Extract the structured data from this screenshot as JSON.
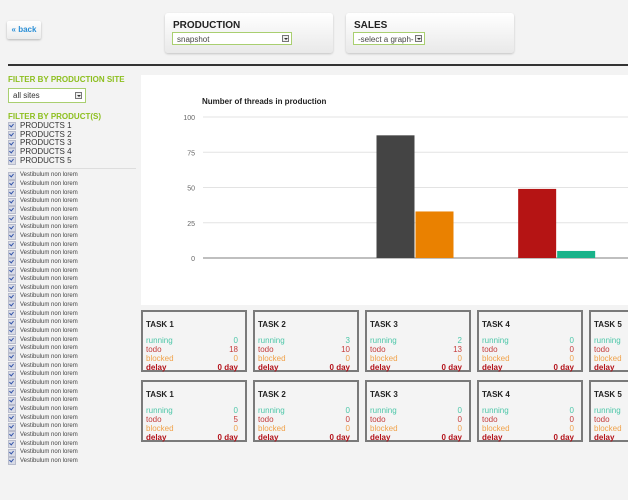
{
  "header": {
    "back_label": "« back",
    "panels": [
      {
        "title": "PRODUCTION",
        "select_value": "snapshot"
      },
      {
        "title": "SALES",
        "select_value": "-select a graph-"
      }
    ]
  },
  "sidebar": {
    "site_filter_heading": "FILTER BY PRODUCTION SITE",
    "site_select_value": "all sites",
    "product_filter_heading": "FILTER BY PRODUCT(S)",
    "products": [
      {
        "label": "PRODUCTS 1",
        "checked": true
      },
      {
        "label": "PRODUCTS 2",
        "checked": true
      },
      {
        "label": "PRODUCTS 3",
        "checked": true
      },
      {
        "label": "PRODUCTS 4",
        "checked": true
      },
      {
        "label": "PRODUCTS 5",
        "checked": true
      }
    ],
    "items_label": "Vestibulum non lorem",
    "items_count": 34
  },
  "chart_data": {
    "type": "bar",
    "title": "Number of threads in production",
    "xlabel": "",
    "ylabel": "",
    "ylim": [
      0,
      100
    ],
    "yticks": [
      0,
      25,
      50,
      75,
      100
    ],
    "grid": true,
    "categories": [
      "",
      "",
      ""
    ],
    "bars": [
      {
        "category": 1,
        "value": 87,
        "color": "#444444"
      },
      {
        "category": 1,
        "value": 33,
        "color": "#ea8100"
      },
      {
        "category": 2,
        "value": 49,
        "color": "#b51414"
      },
      {
        "category": 2,
        "value": 5,
        "color": "#19b38a"
      }
    ]
  },
  "tasks": {
    "labels": {
      "running": "running",
      "todo": "todo",
      "blocked": "blocked",
      "delay": "delay"
    },
    "rows": [
      [
        {
          "name": "TASK 1",
          "running": "0",
          "todo": "18",
          "blocked": "0",
          "delay": "0 day"
        },
        {
          "name": "TASK 2",
          "running": "3",
          "todo": "10",
          "blocked": "0",
          "delay": "0 day"
        },
        {
          "name": "TASK 3",
          "running": "2",
          "todo": "13",
          "blocked": "0",
          "delay": "0 day"
        },
        {
          "name": "TASK 4",
          "running": "0",
          "todo": "0",
          "blocked": "0",
          "delay": "0 day"
        },
        {
          "name": "TASK 5",
          "running": "",
          "todo": "",
          "blocked": "",
          "delay": ""
        }
      ],
      [
        {
          "name": "TASK 1",
          "running": "0",
          "todo": "5",
          "blocked": "0",
          "delay": "0 day"
        },
        {
          "name": "TASK 2",
          "running": "0",
          "todo": "0",
          "blocked": "0",
          "delay": "0 day"
        },
        {
          "name": "TASK 3",
          "running": "0",
          "todo": "0",
          "blocked": "0",
          "delay": "0 day"
        },
        {
          "name": "TASK 4",
          "running": "0",
          "todo": "0",
          "blocked": "0",
          "delay": "0 day"
        },
        {
          "name": "TASK 5",
          "running": "",
          "todo": "",
          "blocked": "",
          "delay": ""
        }
      ]
    ]
  }
}
